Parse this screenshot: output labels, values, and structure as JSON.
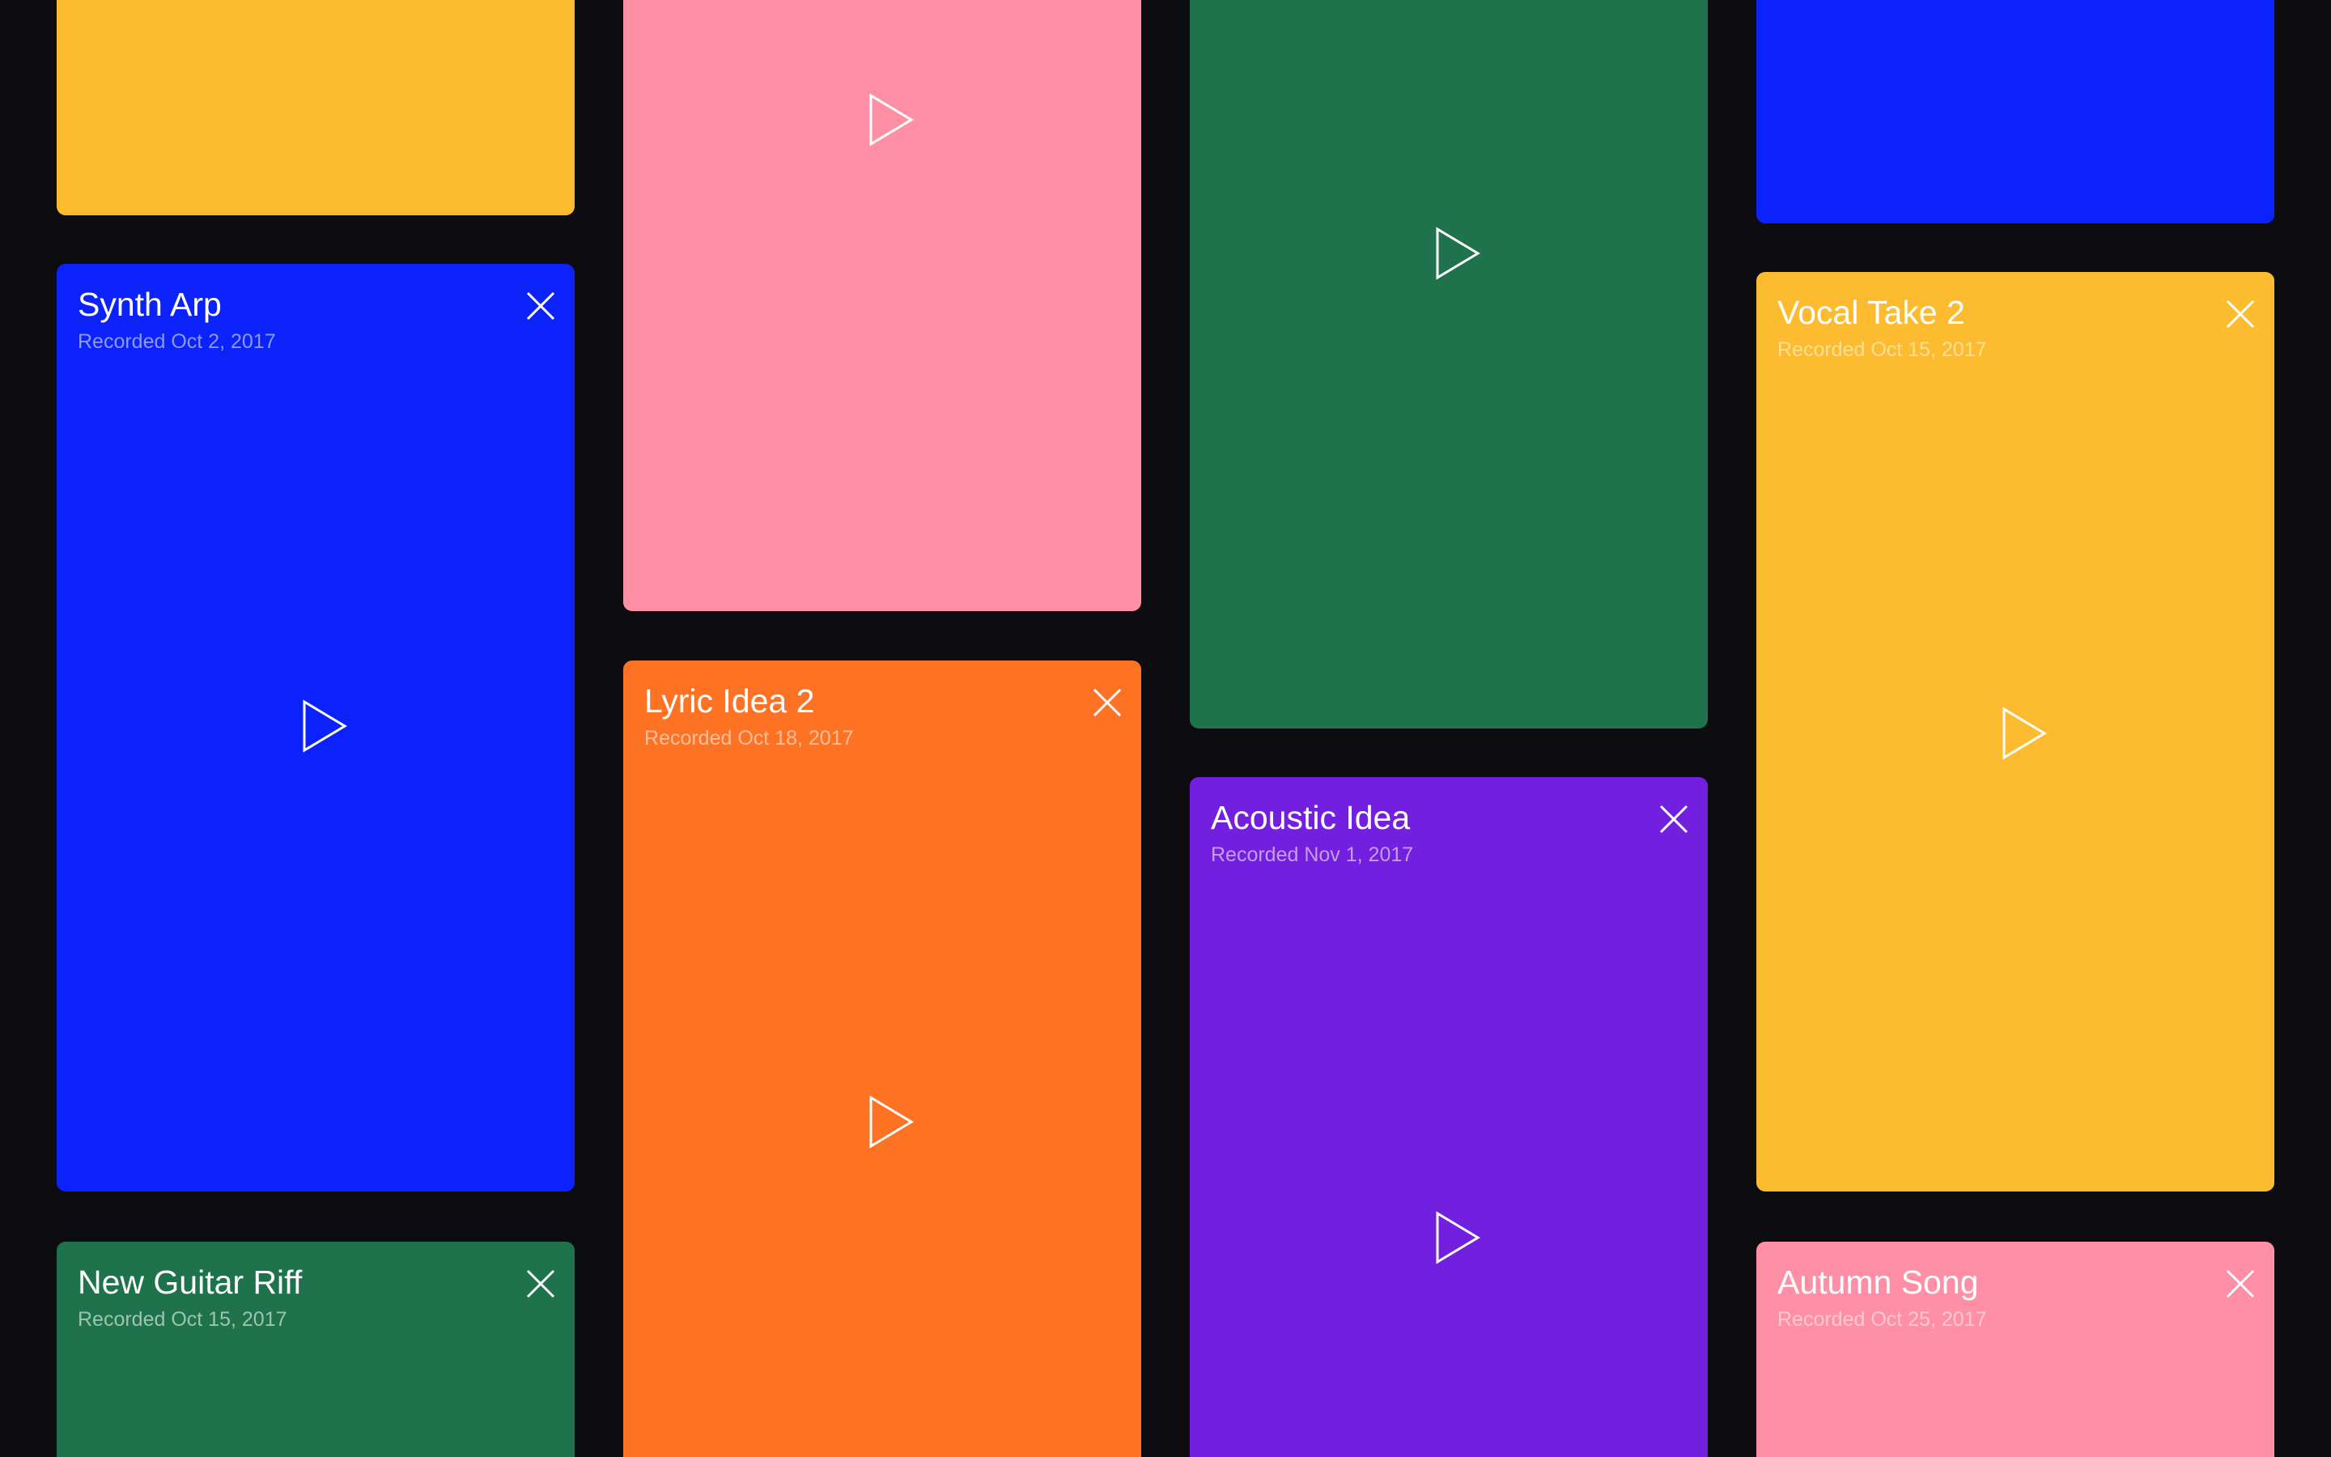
{
  "cards": [
    {
      "id": "yellow-top",
      "color": "#fdbb30",
      "date_color": "#fbd789"
    },
    {
      "id": "synth-arp",
      "title": "Synth Arp",
      "date": "Recorded Oct 2, 2017",
      "color": "#0c22fa",
      "date_color": "#8e99fb"
    },
    {
      "id": "new-guitar-riff",
      "title": "New Guitar Riff",
      "date": "Recorded Oct 15, 2017",
      "color": "#1f734c",
      "date_color": "#9dc3b1"
    },
    {
      "id": "pink-top",
      "color": "#ff8fa5",
      "date_color": "#ffd2dc"
    },
    {
      "id": "lyric-idea-2",
      "title": "Lyric Idea 2",
      "date": "Recorded Oct 18, 2017",
      "color": "#fe7224",
      "date_color": "#ffbf9b"
    },
    {
      "id": "green-top",
      "color": "#1f734c",
      "date_color": "#9dc3b1"
    },
    {
      "id": "acoustic-idea",
      "title": "Acoustic Idea",
      "date": "Recorded Nov 1, 2017",
      "color": "#731fdf",
      "date_color": "#c49ef2"
    },
    {
      "id": "blue-top",
      "color": "#0c22fa",
      "date_color": "#8e99fb"
    },
    {
      "id": "vocal-take-2",
      "title": "Vocal Take 2",
      "date": "Recorded Oct 15, 2017",
      "color": "#fdbb30",
      "date_color": "#fddf97"
    },
    {
      "id": "autumn-song",
      "title": "Autumn Song",
      "date": "Recorded Oct 25, 2017",
      "color": "#ff8fa5",
      "date_color": "#ffcad4"
    }
  ],
  "icons": {
    "play": "play-icon",
    "close": "close-icon"
  }
}
